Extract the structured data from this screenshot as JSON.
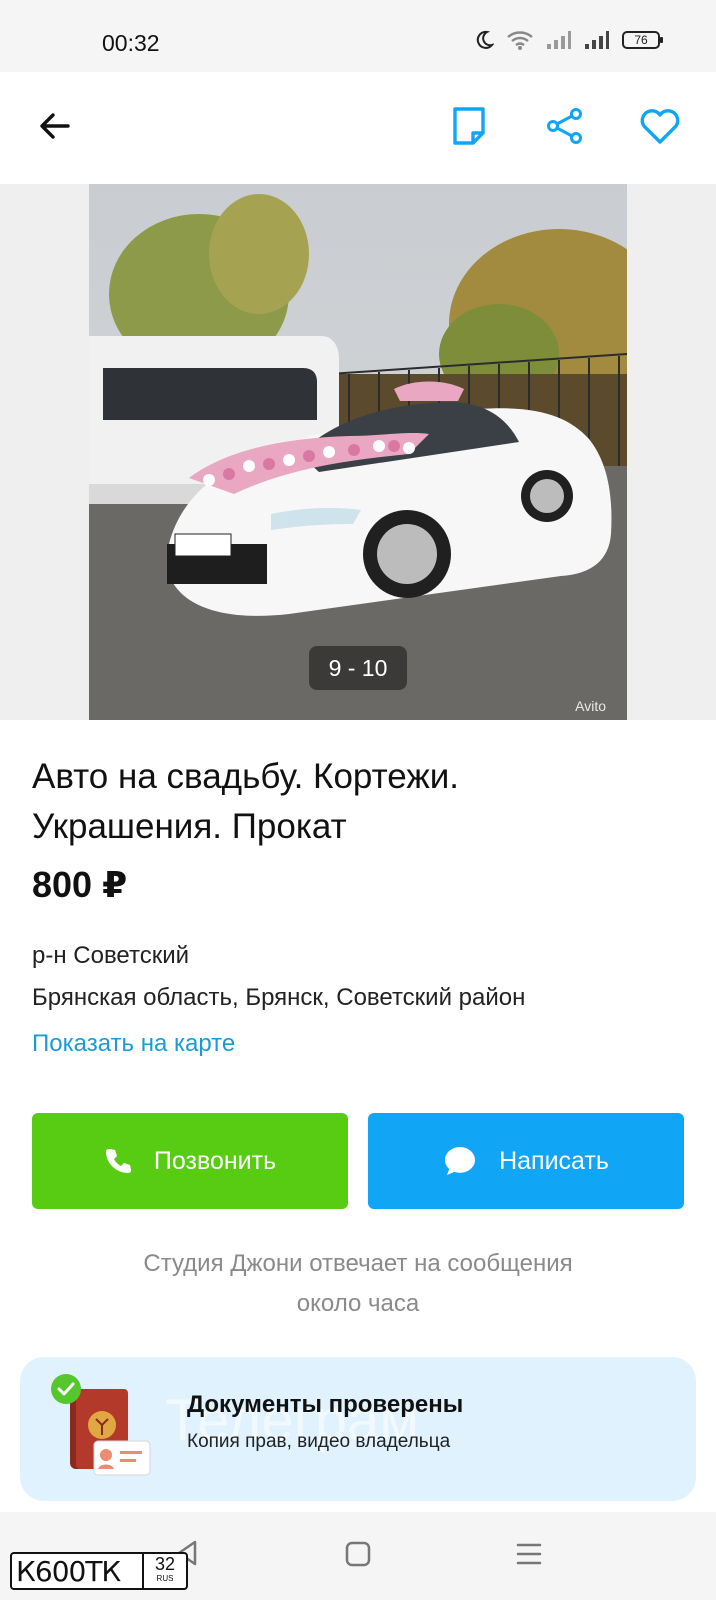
{
  "status_bar": {
    "time": "00:32",
    "battery": "76"
  },
  "app_bar": {
    "icons": [
      "back-arrow-icon",
      "note-icon",
      "share-icon",
      "heart-icon"
    ],
    "accent_color": "#10a5f5"
  },
  "gallery": {
    "counter": "9 - 10",
    "watermark": "Avito",
    "plate_text": "К600ТК",
    "plate_region": "32"
  },
  "listing": {
    "title_line1": "Авто на свадьбу. Кортежи.",
    "title_line2": "Украшения. Прокат",
    "price": "800 ₽",
    "district": "р-н Советский",
    "address": "Брянская область, Брянск, Советский район",
    "map_link": "Показать на карте"
  },
  "actions": {
    "call_label": "Позвонить",
    "call_color": "#57cc12",
    "write_label": "Написать",
    "write_color": "#10a5f5"
  },
  "seller": {
    "reply_note_line1": "Студия Джони отвечает на сообщения",
    "reply_note_line2": "около часа"
  },
  "docs_card": {
    "title": "Документы проверены",
    "subtitle": "Копия прав, видео владельца",
    "background_text": "Телеграм"
  },
  "overlay_plate": {
    "main": "К600ТК",
    "region": "32",
    "country": "RUS"
  }
}
